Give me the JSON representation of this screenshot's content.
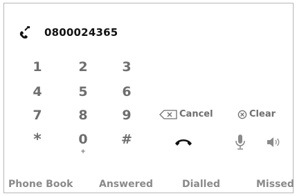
{
  "dialer": {
    "number": "0800024365",
    "keys": [
      "1",
      "2",
      "3",
      "4",
      "5",
      "6",
      "7",
      "8",
      "9",
      "*",
      "0",
      "#"
    ],
    "zero_sub": "+",
    "cancel_label": "Cancel",
    "clear_label": "Clear"
  },
  "nav": {
    "tabs": [
      "Phone Book",
      "Answered",
      "Dialled",
      "Missed"
    ]
  },
  "icons": {
    "call": "phone-outgoing-icon",
    "hangup": "hang-up-icon",
    "mic": "microphone-icon",
    "speaker": "speaker-icon",
    "backspace": "backspace-icon",
    "clear": "clear-icon"
  },
  "colors": {
    "text_dark": "#111111",
    "text_muted": "#6e6e6e",
    "nav_text": "#8a8a8a",
    "border": "#b5b5b5"
  }
}
